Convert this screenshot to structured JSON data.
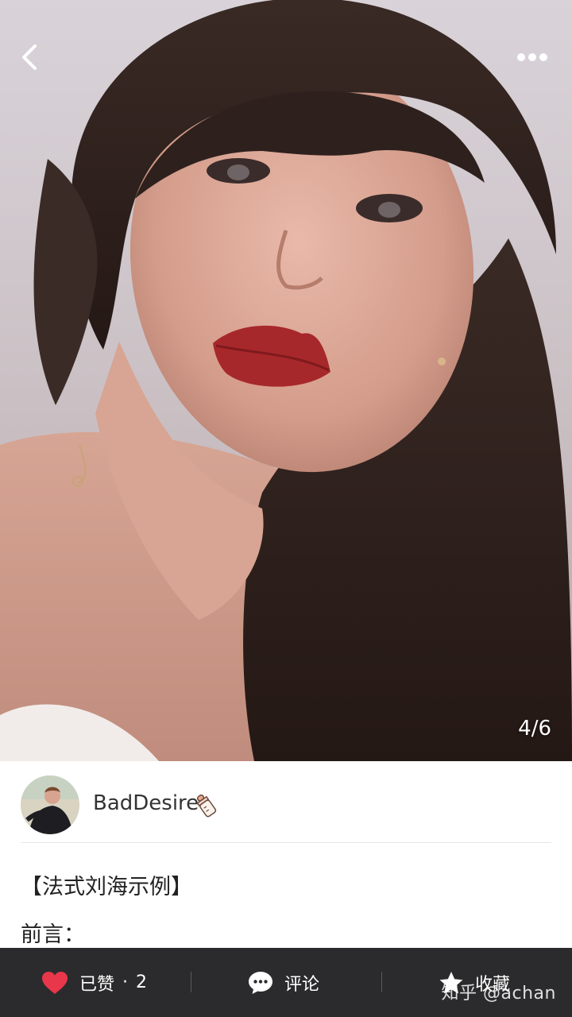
{
  "photo": {
    "description_counter": "4/6"
  },
  "author": {
    "name": "BadDesire"
  },
  "post": {
    "title": "【法式刘海示例】",
    "line1": "前言："
  },
  "actions": {
    "like_label": "已赞",
    "like_sep": "·",
    "like_count": "2",
    "comment_label": "评论",
    "favorite_label": "收藏"
  },
  "watermark": "知乎 @achan",
  "colors": {
    "like_heart": "#e8364b",
    "bottom_bar": "#2b2b2d"
  },
  "icons": {
    "back": "chevron-left-icon",
    "more": "more-dots-icon",
    "badge": "baby-bottle-icon",
    "like": "heart-icon",
    "comment": "comment-bubble-icon",
    "favorite": "star-icon"
  }
}
